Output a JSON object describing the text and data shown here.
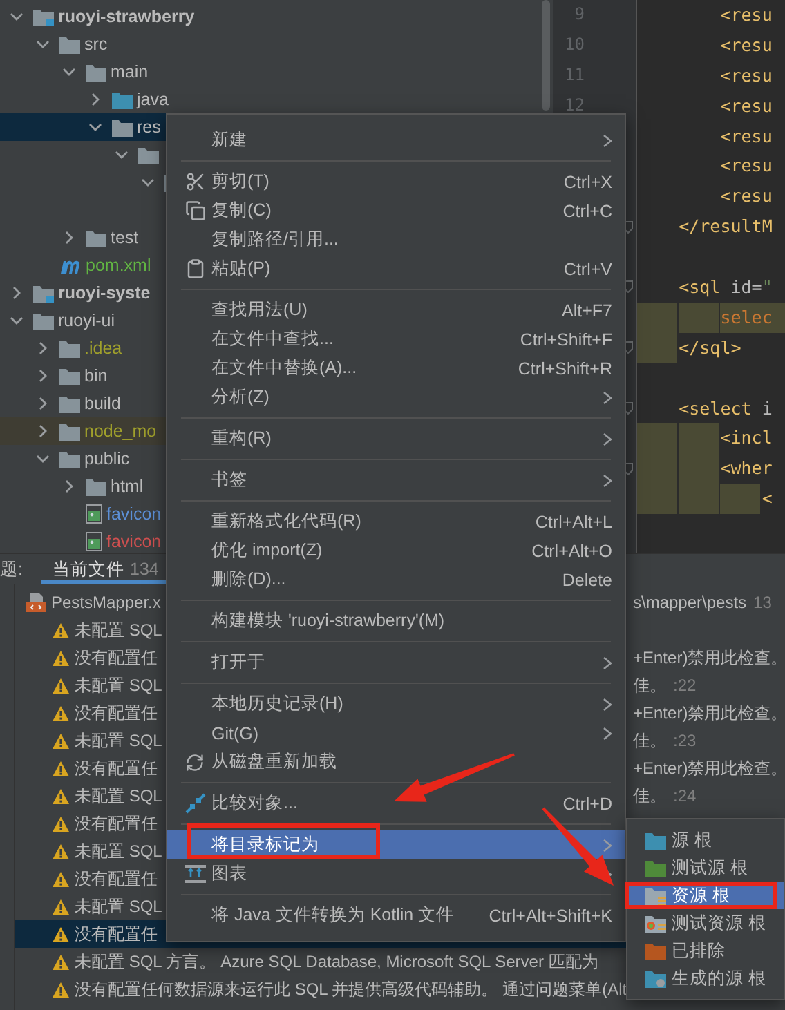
{
  "project_tree": {
    "items": [
      {
        "label": "ruoyi-strawberry",
        "kind": "module",
        "expanded": true,
        "selected": false,
        "children": [
          {
            "label": "src",
            "kind": "folder",
            "expanded": true,
            "selected": false,
            "children": [
              {
                "label": "main",
                "kind": "folder",
                "expanded": true,
                "selected": false,
                "children": [
                  {
                    "label": "java",
                    "kind": "source-folder",
                    "expanded": false,
                    "selected": false
                  },
                  {
                    "label": "res",
                    "kind": "folder",
                    "expanded": true,
                    "selected": true,
                    "children": [
                      {
                        "kind": "folder",
                        "expanded": true,
                        "selected": false,
                        "children": [
                          {
                            "kind": "folder",
                            "expanded": true,
                            "selected": false,
                            "children": [
                              {
                                "kind": "covered"
                              }
                            ]
                          }
                        ]
                      }
                    ]
                  }
                ]
              },
              {
                "label": "test",
                "kind": "folder",
                "expanded": false,
                "selected": false
              }
            ]
          },
          {
            "label": "pom.xml",
            "kind": "maven",
            "selected": false,
            "color": "#62b543"
          }
        ]
      },
      {
        "label": "ruoyi-syste",
        "kind": "module",
        "expanded": false,
        "selected": false
      },
      {
        "label": "ruoyi-ui",
        "kind": "folder",
        "expanded": true,
        "selected": false,
        "children": [
          {
            "label": ".idea",
            "kind": "folder",
            "expanded": false,
            "selected": false,
            "color": "#a0a02c"
          },
          {
            "label": "bin",
            "kind": "folder",
            "expanded": false,
            "selected": false
          },
          {
            "label": "build",
            "kind": "folder",
            "expanded": false,
            "selected": false
          },
          {
            "label": "node_mo",
            "kind": "folder",
            "expanded": false,
            "selected": false,
            "ignored": true,
            "color": "#a0a02c"
          },
          {
            "label": "public",
            "kind": "folder",
            "expanded": true,
            "selected": false,
            "children": [
              {
                "label": "html",
                "kind": "folder",
                "expanded": false,
                "selected": false
              },
              {
                "label": "favicon",
                "kind": "image",
                "selected": false,
                "color": "#5c8fd6"
              },
              {
                "label": "favicon",
                "kind": "image",
                "selected": false,
                "color": "#d05050"
              }
            ]
          }
        ]
      }
    ]
  },
  "editor": {
    "lines": [
      {
        "kind": "code",
        "number": "9",
        "tokens": [
          {
            "text": "        <resu",
            "kind": "tag"
          }
        ]
      },
      {
        "kind": "code",
        "number": "10",
        "tokens": [
          {
            "text": "        <resu",
            "kind": "tag"
          }
        ]
      },
      {
        "kind": "code",
        "number": "11",
        "tokens": [
          {
            "text": "        <resu",
            "kind": "tag"
          }
        ]
      },
      {
        "kind": "code",
        "number": "12",
        "tokens": [
          {
            "text": "        <resu",
            "kind": "tag"
          }
        ]
      },
      {
        "kind": "code",
        "tokens": [
          {
            "text": "        <resu",
            "kind": "tag"
          }
        ]
      },
      {
        "kind": "code",
        "tokens": [
          {
            "text": "        <resu",
            "kind": "tag"
          }
        ]
      },
      {
        "kind": "code",
        "tokens": [
          {
            "text": "        <resu",
            "kind": "tag"
          }
        ]
      },
      {
        "kind": "code",
        "fold": true,
        "tokens": [
          {
            "text": "    </resultM",
            "kind": "tag"
          }
        ]
      },
      {
        "kind": "blank"
      },
      {
        "kind": "code",
        "fold": true,
        "tokens": [
          {
            "text": "    <sql",
            "kind": "tag"
          },
          {
            "text": " id=",
            "kind": "attr"
          },
          {
            "text": "\"",
            "kind": "string"
          }
        ]
      },
      {
        "kind": "highlighted",
        "tokens": [
          {
            "text": "        selec",
            "kind": "keyword"
          }
        ]
      },
      {
        "kind": "code",
        "fold": true,
        "indent_marked": true,
        "tokens": [
          {
            "text": "    </sql>",
            "kind": "tag"
          }
        ]
      },
      {
        "kind": "blank"
      },
      {
        "kind": "code",
        "fold": true,
        "tokens": [
          {
            "text": "    <select",
            "kind": "tag"
          },
          {
            "text": " i",
            "kind": "attr"
          }
        ]
      },
      {
        "kind": "code",
        "indent_marked": true,
        "tokens": [
          {
            "text": "        <incl",
            "kind": "tag"
          }
        ]
      },
      {
        "kind": "code",
        "fold": true,
        "indent_marked": true,
        "tokens": [
          {
            "text": "        <wher",
            "kind": "tag"
          }
        ]
      },
      {
        "kind": "code",
        "indent_marked": true,
        "tokens": [
          {
            "text": "            <",
            "kind": "tag"
          }
        ]
      }
    ]
  },
  "problems_panel": {
    "title": "题:",
    "tabs": [
      {
        "label": "当前文件",
        "count": "134",
        "selected": true
      }
    ],
    "rows": [
      {
        "kind": "file",
        "label": "PestsMapper.x",
        "tail": "s\\mapper\\pests",
        "line": "13",
        "selected": false
      },
      {
        "kind": "warning",
        "label": "未配置 SQL",
        "selected": false
      },
      {
        "kind": "warning",
        "label": "没有配置任",
        "tail": "+Enter)禁用此检查。",
        "selected": false
      },
      {
        "kind": "warning",
        "label": "未配置 SQL",
        "tail": "佳。",
        "line": ":22",
        "selected": false
      },
      {
        "kind": "warning",
        "label": "没有配置任",
        "tail": "+Enter)禁用此检查。",
        "selected": false
      },
      {
        "kind": "warning",
        "label": "未配置 SQL",
        "tail": "佳。",
        "line": ":23",
        "selected": false
      },
      {
        "kind": "warning",
        "label": "没有配置任",
        "tail": "+Enter)禁用此检查。",
        "selected": false
      },
      {
        "kind": "warning",
        "label": "未配置 SQL",
        "tail": "佳。",
        "line": ":24",
        "selected": false
      },
      {
        "kind": "warning",
        "label": "没有配置任",
        "selected": false
      },
      {
        "kind": "warning",
        "label": "未配置 SQL",
        "selected": false
      },
      {
        "kind": "warning",
        "label": "没有配置任",
        "selected": false
      },
      {
        "kind": "warning",
        "label": "未配置 SQL",
        "selected": false
      },
      {
        "kind": "warning",
        "label": "没有配置任",
        "selected": true
      },
      {
        "kind": "warning",
        "label": "未配置 SQL 方言。 Azure SQL Database, Microsoft SQL Server 匹配为",
        "selected": false
      },
      {
        "kind": "warning",
        "label": "没有配置任何数据源来运行此 SQL 并提供高级代码辅助。 通过问题菜单(Alt",
        "selected": false
      }
    ]
  },
  "context_menu": {
    "items": [
      {
        "kind": "item",
        "label": "新建",
        "submenu": true,
        "selected": false
      },
      {
        "kind": "separator"
      },
      {
        "kind": "cut",
        "label": "剪切(T)",
        "shortcut": "Ctrl+X",
        "selected": false
      },
      {
        "kind": "copy",
        "label": "复制(C)",
        "shortcut": "Ctrl+C",
        "selected": false
      },
      {
        "kind": "item",
        "label": "复制路径/引用...",
        "selected": false
      },
      {
        "kind": "paste",
        "label": "粘贴(P)",
        "shortcut": "Ctrl+V",
        "selected": false
      },
      {
        "kind": "separator"
      },
      {
        "kind": "item",
        "label": "查找用法(U)",
        "shortcut": "Alt+F7",
        "selected": false
      },
      {
        "kind": "item",
        "label": "在文件中查找...",
        "shortcut": "Ctrl+Shift+F",
        "selected": false
      },
      {
        "kind": "item",
        "label": "在文件中替换(A)...",
        "shortcut": "Ctrl+Shift+R",
        "selected": false
      },
      {
        "kind": "item",
        "label": "分析(Z)",
        "submenu": true,
        "selected": false
      },
      {
        "kind": "separator"
      },
      {
        "kind": "item",
        "label": "重构(R)",
        "submenu": true,
        "selected": false
      },
      {
        "kind": "separator"
      },
      {
        "kind": "item",
        "label": "书签",
        "submenu": true,
        "selected": false
      },
      {
        "kind": "separator"
      },
      {
        "kind": "item",
        "label": "重新格式化代码(R)",
        "shortcut": "Ctrl+Alt+L",
        "selected": false
      },
      {
        "kind": "item",
        "label": "优化 import(Z)",
        "shortcut": "Ctrl+Alt+O",
        "selected": false
      },
      {
        "kind": "item",
        "label": "删除(D)...",
        "shortcut": "Delete",
        "selected": false
      },
      {
        "kind": "separator"
      },
      {
        "kind": "item",
        "label": "构建模块 'ruoyi-strawberry'(M)",
        "selected": false
      },
      {
        "kind": "separator"
      },
      {
        "kind": "item",
        "label": "打开于",
        "submenu": true,
        "selected": false
      },
      {
        "kind": "separator"
      },
      {
        "kind": "item",
        "label": "本地历史记录(H)",
        "submenu": true,
        "selected": false
      },
      {
        "kind": "item",
        "label": "Git(G)",
        "submenu": true,
        "selected": false
      },
      {
        "kind": "reload",
        "label": "从磁盘重新加载",
        "selected": false
      },
      {
        "kind": "separator"
      },
      {
        "kind": "compare",
        "label": "比较对象...",
        "shortcut": "Ctrl+D",
        "selected": false
      },
      {
        "kind": "separator"
      },
      {
        "kind": "item",
        "label": "将目录标记为",
        "submenu": true,
        "selected": true,
        "boxed": true
      },
      {
        "kind": "diagram",
        "label": "图表",
        "submenu": true,
        "selected": false
      },
      {
        "kind": "separator"
      },
      {
        "kind": "item",
        "label": "将 Java 文件转换为 Kotlin 文件",
        "shortcut": "Ctrl+Alt+Shift+K",
        "selected": false
      }
    ]
  },
  "submenu": {
    "items": [
      {
        "kind": "source",
        "label": "源 根",
        "selected": false
      },
      {
        "kind": "test-source",
        "label": "测试源 根",
        "selected": false
      },
      {
        "kind": "resource",
        "label": "资源 根",
        "selected": true,
        "boxed": true
      },
      {
        "kind": "test-resource",
        "label": "测试资源 根",
        "selected": false
      },
      {
        "kind": "excluded",
        "label": "已排除",
        "selected": false
      },
      {
        "kind": "generated",
        "label": "生成的源 根",
        "selected": false
      }
    ]
  },
  "annotations": [
    {
      "kind": "arrow"
    },
    {
      "kind": "arrow"
    }
  ]
}
